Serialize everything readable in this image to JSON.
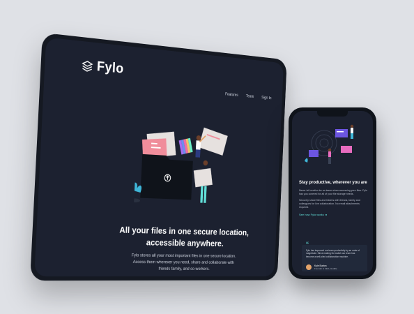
{
  "tablet": {
    "logo_text": "Fylo",
    "nav": [
      "Features",
      "Team",
      "Sign In"
    ],
    "headline_line1": "All your files in one secure location,",
    "headline_line2": "accessible anywhere.",
    "subtext_line1": "Fylo stores all your most important files in one secure location.",
    "subtext_line2": "Access them wherever you need, share and collaborate with",
    "subtext_line3": "friends family, and co-workers."
  },
  "phone": {
    "title": "Stay productive, wherever you are",
    "para1": "Never let location be an issue when accessing your files. Fylo has you covered for all of your file storage needs.",
    "para2": "Securely share files and folders with friends, family and colleagues for live collaboration. No email attachments required.",
    "link": "See how Fylo works",
    "testimonial": {
      "text": "Fylo has improved our team productivity by an order of magnitude. Since making the switch our team has become a well-oiled collaboration machine.",
      "author": "Kyle Burton",
      "role": "Founder & CEO, Huddle"
    }
  },
  "colors": {
    "background": "#dfe1e6",
    "screen": "#1c2130",
    "accent": "#62e0d9"
  }
}
